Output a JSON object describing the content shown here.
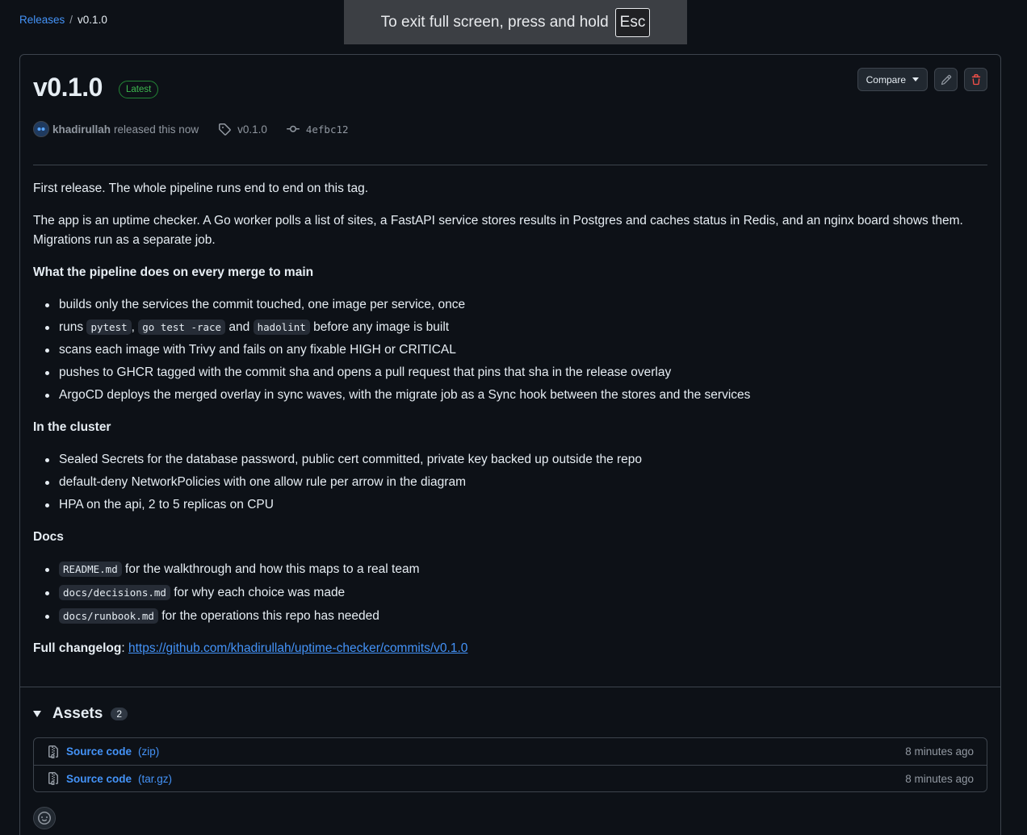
{
  "breadcrumb": {
    "releases": "Releases",
    "separator": "/",
    "current": "v0.1.0"
  },
  "fullscreen_toast": {
    "text": "To exit full screen, press and hold",
    "key": "Esc"
  },
  "release": {
    "title": "v0.1.0",
    "badge": "Latest",
    "compare_label": "Compare",
    "author": "khadirullah",
    "released_text": "released this now",
    "tag": "v0.1.0",
    "commit": "4efbc12"
  },
  "notes": {
    "p1": "First release. The whole pipeline runs end to end on this tag.",
    "p2": "The app is an uptime checker. A Go worker polls a list of sites, a FastAPI service stores results in Postgres and caches status in Redis, and an nginx board shows them. Migrations run as a separate job.",
    "h_pipeline": "What the pipeline does on every merge to main",
    "pipeline": {
      "item1": "builds only the services the commit touched, one image per service, once",
      "item2_prefix": "runs ",
      "item2_code1": "pytest",
      "item2_comma": ", ",
      "item2_code2": "go test -race",
      "item2_and": " and ",
      "item2_code3": "hadolint",
      "item2_suffix": " before any image is built",
      "item3": "scans each image with Trivy and fails on any fixable HIGH or CRITICAL",
      "item4": "pushes to GHCR tagged with the commit sha and opens a pull request that pins that sha in the release overlay",
      "item5": "ArgoCD deploys the merged overlay in sync waves, with the migrate job as a Sync hook between the stores and the services"
    },
    "h_cluster": "In the cluster",
    "cluster": [
      "Sealed Secrets for the database password, public cert committed, private key backed up outside the repo",
      "default-deny NetworkPolicies with one allow rule per arrow in the diagram",
      "HPA on the api, 2 to 5 replicas on CPU"
    ],
    "h_docs": "Docs",
    "docs": [
      {
        "code": "README.md",
        "text": " for the walkthrough and how this maps to a real team"
      },
      {
        "code": "docs/decisions.md",
        "text": " for why each choice was made"
      },
      {
        "code": "docs/runbook.md",
        "text": " for the operations this repo has needed"
      }
    ],
    "changelog_label": "Full changelog",
    "changelog_colon": ": ",
    "changelog_url": "https://github.com/khadirullah/uptime-checker/commits/v0.1.0"
  },
  "assets": {
    "title": "Assets",
    "count": "2",
    "items": [
      {
        "name": "Source code",
        "ext": "(zip)",
        "time": "8 minutes ago"
      },
      {
        "name": "Source code",
        "ext": "(tar.gz)",
        "time": "8 minutes ago"
      }
    ]
  },
  "colors": {
    "accent": "#4493f8",
    "latest": "#3fb950",
    "danger": "#f85149",
    "background": "#0d1117"
  }
}
